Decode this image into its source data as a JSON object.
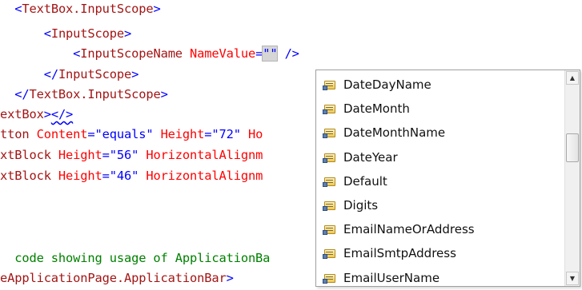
{
  "editor": {
    "lines": [
      {
        "indent": "  ",
        "segments": [
          {
            "t": "<",
            "c": "punct"
          },
          {
            "t": "TextBox.InputScope",
            "c": "tag"
          },
          {
            "t": ">",
            "c": "punct"
          }
        ]
      },
      {
        "indent": "      ",
        "segments": [
          {
            "t": "<",
            "c": "punct"
          },
          {
            "t": "InputScope",
            "c": "tag"
          },
          {
            "t": ">",
            "c": "punct"
          }
        ]
      },
      {
        "indent": "          ",
        "segments": [
          {
            "t": "<",
            "c": "punct"
          },
          {
            "t": "InputScopeName",
            "c": "tag"
          },
          {
            "t": " NameValue",
            "c": "attr"
          },
          {
            "t": "=",
            "c": "punct"
          },
          {
            "t": "\"\"",
            "c": "punct sel"
          },
          {
            "t": " />",
            "c": "punct"
          }
        ]
      },
      {
        "indent": "      ",
        "segments": [
          {
            "t": "</",
            "c": "punct"
          },
          {
            "t": "InputScope",
            "c": "tag"
          },
          {
            "t": ">",
            "c": "punct"
          }
        ]
      },
      {
        "indent": "  ",
        "segments": [
          {
            "t": "</",
            "c": "punct"
          },
          {
            "t": "TextBox.InputScope",
            "c": "tag"
          },
          {
            "t": ">",
            "c": "punct"
          }
        ]
      },
      {
        "indent": "",
        "segments": [
          {
            "t": "extBox",
            "c": "tag"
          },
          {
            "t": ">",
            "c": "punct"
          },
          {
            "t": "</>",
            "c": "punct squig"
          }
        ]
      },
      {
        "indent": "",
        "segments": [
          {
            "t": "tton",
            "c": "tag"
          },
          {
            "t": " Content",
            "c": "attr"
          },
          {
            "t": "=\"equals\"",
            "c": "punct"
          },
          {
            "t": " Height",
            "c": "attr"
          },
          {
            "t": "=\"72\"",
            "c": "punct"
          },
          {
            "t": " Ho",
            "c": "attr"
          }
        ]
      },
      {
        "indent": "",
        "segments": [
          {
            "t": "xtBlock",
            "c": "tag"
          },
          {
            "t": " Height",
            "c": "attr"
          },
          {
            "t": "=\"56\"",
            "c": "punct"
          },
          {
            "t": " HorizontalAlignm",
            "c": "attr"
          }
        ]
      },
      {
        "indent": "",
        "segments": [
          {
            "t": "xtBlock",
            "c": "tag"
          },
          {
            "t": " Height",
            "c": "attr"
          },
          {
            "t": "=\"46\"",
            "c": "punct"
          },
          {
            "t": " HorizontalAlignm",
            "c": "attr"
          }
        ]
      },
      {
        "indent": "",
        "segments": []
      },
      {
        "indent": "",
        "segments": []
      },
      {
        "indent": "",
        "segments": []
      },
      {
        "indent": "",
        "segments": [
          {
            "t": "  code showing usage of ApplicationBa",
            "c": "comment"
          }
        ]
      },
      {
        "indent": "",
        "segments": [
          {
            "t": "eApplicationPage.ApplicationBar",
            "c": "tag"
          },
          {
            "t": ">",
            "c": "punct"
          }
        ]
      }
    ]
  },
  "completion": {
    "icon": "enum-member-icon",
    "items": [
      "DateDayName",
      "DateMonth",
      "DateMonthName",
      "DateYear",
      "Default",
      "Digits",
      "EmailNameOrAddress",
      "EmailSmtpAddress",
      "EmailUserName"
    ],
    "scroll_up_glyph": "▲",
    "scroll_down_glyph": "▼"
  }
}
